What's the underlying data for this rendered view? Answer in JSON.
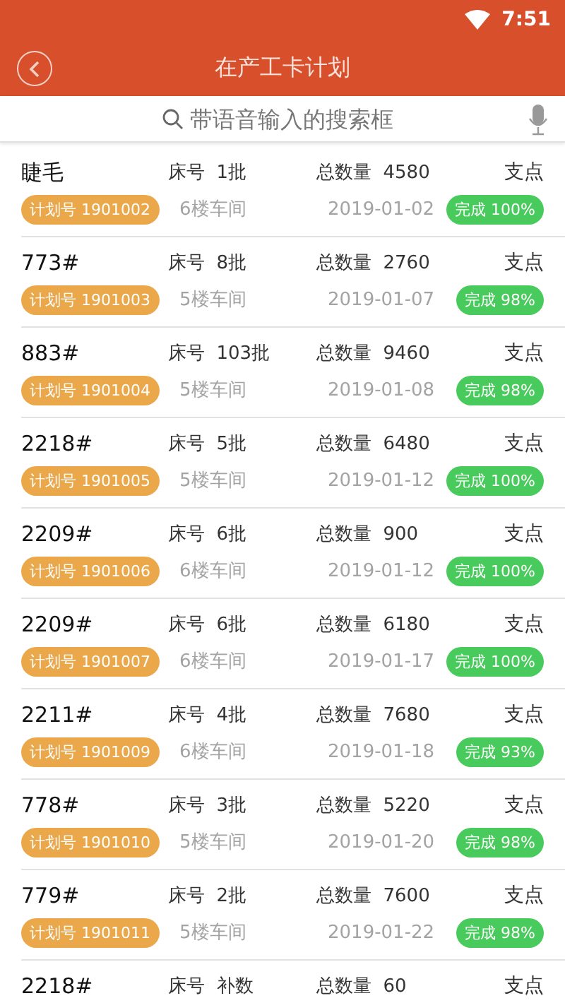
{
  "status_bar": {
    "time": "7:51"
  },
  "header": {
    "title": "在产工卡计划"
  },
  "search": {
    "placeholder": "带语音输入的搜索框"
  },
  "rows": [
    {
      "name": "睫毛",
      "bed_label": "床号",
      "bed": "1批",
      "total_label": "总数量",
      "total": "4580",
      "unit": "支点",
      "plan": "计划号 1901002",
      "workshop": "6楼车间",
      "date": "2019-01-02",
      "progress": "完成 100%"
    },
    {
      "name": "773#",
      "bed_label": "床号",
      "bed": "8批",
      "total_label": "总数量",
      "total": "2760",
      "unit": "支点",
      "plan": "计划号 1901003",
      "workshop": "5楼车间",
      "date": "2019-01-07",
      "progress": "完成 98%"
    },
    {
      "name": "883#",
      "bed_label": "床号",
      "bed": "103批",
      "total_label": "总数量",
      "total": "9460",
      "unit": "支点",
      "plan": "计划号 1901004",
      "workshop": "5楼车间",
      "date": "2019-01-08",
      "progress": "完成 98%"
    },
    {
      "name": "2218#",
      "bed_label": "床号",
      "bed": "5批",
      "total_label": "总数量",
      "total": "6480",
      "unit": "支点",
      "plan": "计划号 1901005",
      "workshop": "5楼车间",
      "date": "2019-01-12",
      "progress": "完成 100%"
    },
    {
      "name": "2209#",
      "bed_label": "床号",
      "bed": "6批",
      "total_label": "总数量",
      "total": "900",
      "unit": "支点",
      "plan": "计划号 1901006",
      "workshop": "6楼车间",
      "date": "2019-01-12",
      "progress": "完成 100%"
    },
    {
      "name": "2209#",
      "bed_label": "床号",
      "bed": "6批",
      "total_label": "总数量",
      "total": "6180",
      "unit": "支点",
      "plan": "计划号 1901007",
      "workshop": "6楼车间",
      "date": "2019-01-17",
      "progress": "完成 100%"
    },
    {
      "name": "2211#",
      "bed_label": "床号",
      "bed": "4批",
      "total_label": "总数量",
      "total": "7680",
      "unit": "支点",
      "plan": "计划号 1901009",
      "workshop": "6楼车间",
      "date": "2019-01-18",
      "progress": "完成 93%"
    },
    {
      "name": "778#",
      "bed_label": "床号",
      "bed": "3批",
      "total_label": "总数量",
      "total": "5220",
      "unit": "支点",
      "plan": "计划号 1901010",
      "workshop": "5楼车间",
      "date": "2019-01-20",
      "progress": "完成 98%"
    },
    {
      "name": "779#",
      "bed_label": "床号",
      "bed": "2批",
      "total_label": "总数量",
      "total": "7600",
      "unit": "支点",
      "plan": "计划号 1901011",
      "workshop": "5楼车间",
      "date": "2019-01-22",
      "progress": "完成 98%"
    },
    {
      "name": "2218#",
      "bed_label": "床号",
      "bed": "补数",
      "total_label": "总数量",
      "total": "60",
      "unit": "支点"
    }
  ]
}
